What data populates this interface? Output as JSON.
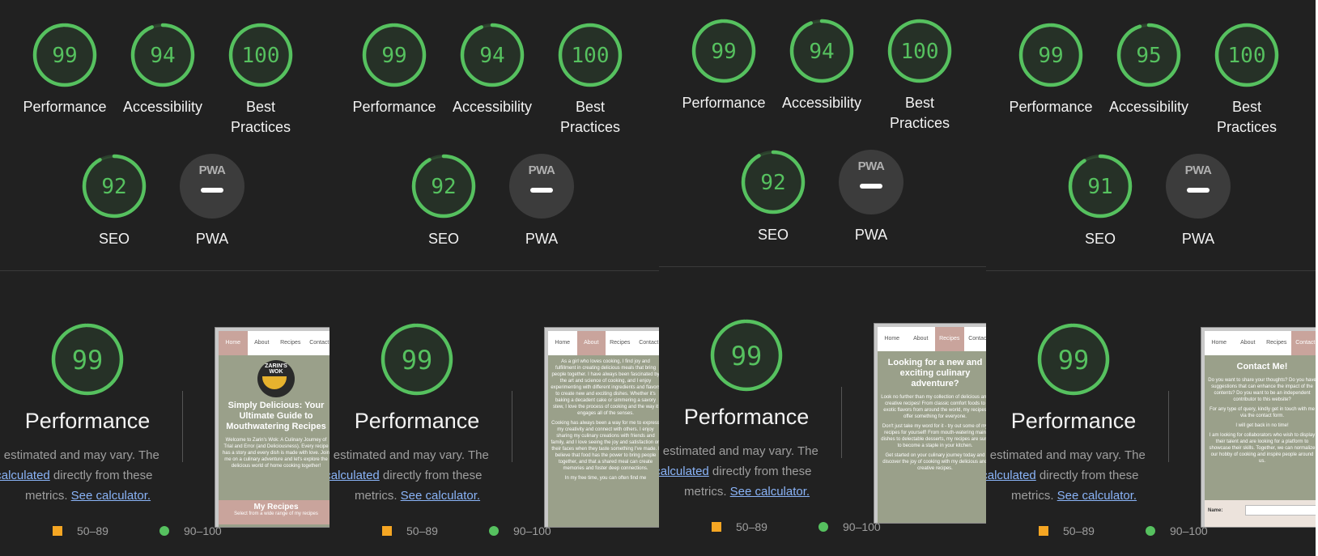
{
  "colors": {
    "pass_green": "#56c15f",
    "average_orange": "#f5a623",
    "panel_bg": "#212121",
    "link_blue": "#8ab4f8"
  },
  "labels": {
    "performance": "Performance",
    "accessibility": "Accessibility",
    "best_practices_1": "Best",
    "best_practices_2": "Practices",
    "seo": "SEO",
    "pwa": "PWA",
    "pwa_badge": "PWA"
  },
  "note": {
    "line1": "Values are estimated and may vary. The",
    "link1": "performance score is calculated",
    "line2_rest": " directly from these",
    "line3_pre": "metrics. ",
    "link2": "See calculator."
  },
  "legend": {
    "average": "50–89",
    "pass": "90–100"
  },
  "panels": [
    {
      "scores": {
        "performance": "99",
        "accessibility": "94",
        "best_practices": "100",
        "seo": "92",
        "performance_big": "99"
      },
      "score_values": {
        "performance": 99,
        "accessibility": 94,
        "best_practices": 100,
        "seo": 92
      },
      "thumbnail": {
        "nav": [
          "Home",
          "About",
          "Recipes",
          "Contact"
        ],
        "active": 0,
        "logo": "ZARIN'S WOK",
        "heading": "Simply Delicious: Your Ultimate Guide to Mouthwatering Recipes",
        "text": "Welcome to Zarin's Wok: A Culinary Journey of Trial and Error (and Deliciousness). Every recipe has a story and every dish is made with love. Join me on a culinary adventure and let's explore the delicious world of home cooking together!",
        "footer": "My Recipes",
        "footer_sub": "Select from a wide range of my recipes"
      }
    },
    {
      "scores": {
        "performance": "99",
        "accessibility": "94",
        "best_practices": "100",
        "seo": "92",
        "performance_big": "99"
      },
      "score_values": {
        "performance": 99,
        "accessibility": 94,
        "best_practices": 100,
        "seo": 92
      },
      "thumbnail": {
        "nav": [
          "Home",
          "About",
          "Recipes",
          "Contact"
        ],
        "active": 1,
        "heading": "",
        "text": "As a girl who loves cooking, I find joy and fulfillment in creating delicious meals that bring people together. I have always been fascinated by the art and science of cooking, and I enjoy experimenting with different ingredients and flavors to create new and exciting dishes. Whether it's baking a decadent cake or simmering a savory stew, I love the process of cooking and the way it engages all of the senses.",
        "text2": "Cooking has always been a way for me to express my creativity and connect with others. I enjoy sharing my culinary creations with friends and family, and I love seeing the joy and satisfaction on their faces when they taste something I've made. I believe that food has the power to bring people together, and that a shared meal can create memories and foster deep connections.",
        "text3": "In my free time, you can often find me"
      }
    },
    {
      "scores": {
        "performance": "99",
        "accessibility": "94",
        "best_practices": "100",
        "seo": "92",
        "performance_big": "99"
      },
      "score_values": {
        "performance": 99,
        "accessibility": 94,
        "best_practices": 100,
        "seo": 92
      },
      "thumbnail": {
        "nav": [
          "Home",
          "About",
          "Recipes",
          "Contact"
        ],
        "active": 2,
        "heading": "Looking for a new and exciting culinary adventure?",
        "text": "Look no further than my collection of delicious and creative recipes! From classic comfort foods to exotic flavors from around the world, my recipes offer something for everyone.",
        "text2": "Don't just take my word for it - try out some of my recipes for yourself! From mouth-watering main dishes to delectable desserts, my recipes are sure to become a staple in your kitchen.",
        "text3": "Get started on your culinary journey today and discover the joy of cooking with my delicious and creative recipes."
      }
    },
    {
      "scores": {
        "performance": "99",
        "accessibility": "95",
        "best_practices": "100",
        "seo": "91",
        "performance_big": "99"
      },
      "score_values": {
        "performance": 99,
        "accessibility": 95,
        "best_practices": 100,
        "seo": 91
      },
      "thumbnail": {
        "nav": [
          "Home",
          "About",
          "Recipes",
          "Contact"
        ],
        "active": 3,
        "heading": "Contact Me!",
        "text": "Do you want to share your thoughts? Do you have suggestions that can enhance the impact of the contents? Do you want to be an independent contributor to this website?",
        "text2": "For any type of query, kindly get in touch with me via the contact form.",
        "text3": "I will get back in no time!",
        "text4": "I am looking for collaborators who wish to display their talent and are looking for a platform to showcase their skills. Together, we can normalize our hobby of cooking and inspire people around us.",
        "form_label": "Name:"
      }
    }
  ]
}
